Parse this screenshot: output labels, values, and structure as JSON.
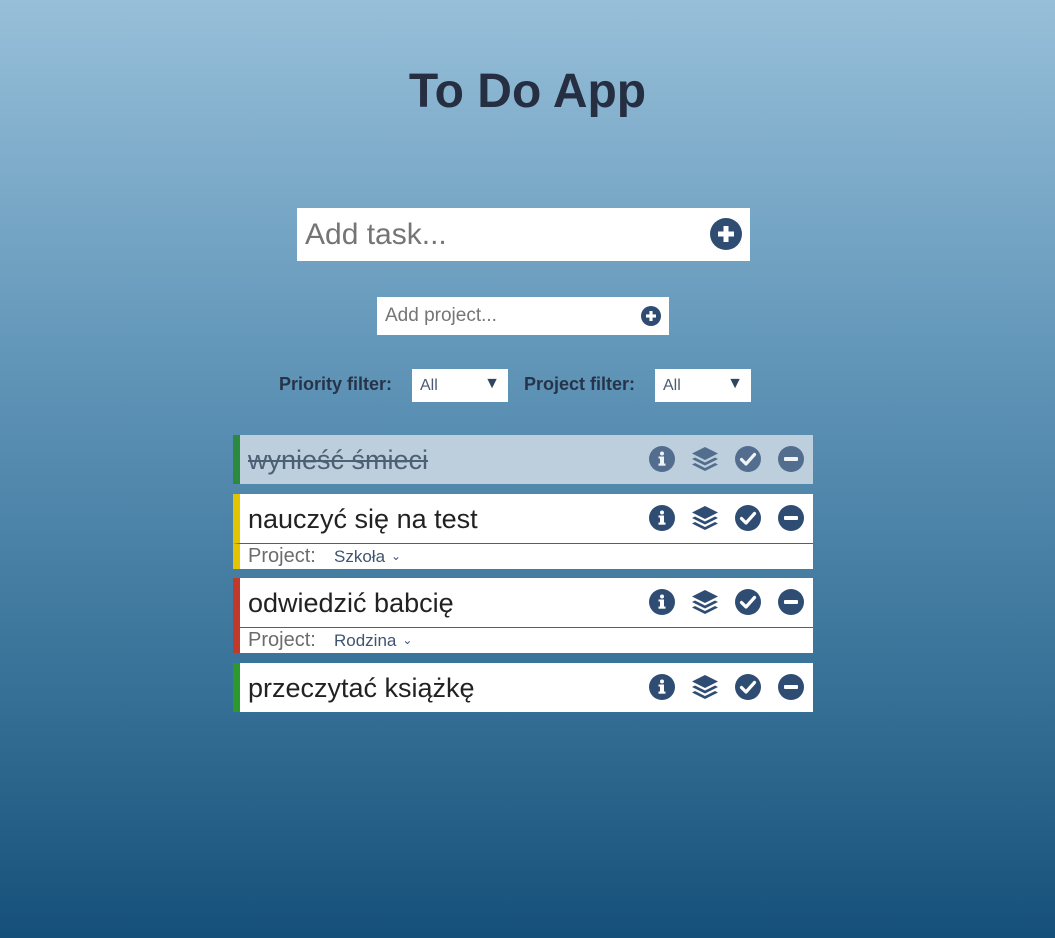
{
  "app": {
    "title": "To Do App"
  },
  "add_task": {
    "placeholder": "Add task..."
  },
  "add_project": {
    "placeholder": "Add project..."
  },
  "filters": {
    "priority": {
      "label": "Priority filter:",
      "value": "All"
    },
    "project": {
      "label": "Project filter:",
      "value": "All"
    }
  },
  "tasks": [
    {
      "name": "wynieść śmieci",
      "done": true,
      "priority_color": "#2a8a3f",
      "project_label": "",
      "project": ""
    },
    {
      "name": "nauczyć się na test",
      "done": false,
      "priority_color": "#e3c400",
      "project_label": "Project:",
      "project": "Szkoła"
    },
    {
      "name": "odwiedzić babcię",
      "done": false,
      "priority_color": "#c0392b",
      "project_label": "Project:",
      "project": "Rodzina"
    },
    {
      "name": "przeczytać książkę",
      "done": false,
      "priority_color": "#2a9a2e",
      "project_label": "",
      "project": ""
    }
  ],
  "icons": [
    "plus-circle-icon",
    "info-icon",
    "layers-icon",
    "check-circle-icon",
    "minus-circle-icon",
    "chevron-down-icon",
    "triangle-down-icon"
  ],
  "colors": {
    "icon": "#2f4d73",
    "text": "#26344a"
  }
}
